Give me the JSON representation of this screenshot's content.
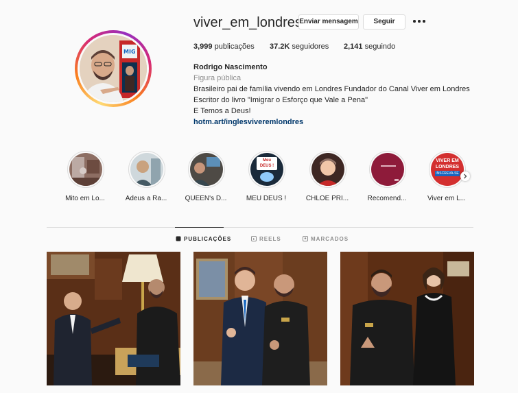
{
  "profile": {
    "username": "viver_em_londres",
    "message_button": "Enviar mensagem",
    "follow_button": "Seguir",
    "stats": {
      "posts_count": "3,999",
      "posts_label": "publicações",
      "followers_count": "37.2K",
      "followers_label": "seguidores",
      "following_count": "2,141",
      "following_label": "seguindo"
    },
    "full_name": "Rodrigo Nascimento",
    "category": "Figura pública",
    "bio_lines": [
      "Brasileiro pai de família vivendo em Londres Fundador do Canal Viver em Londres",
      "Escritor do livro \"Imigrar o Esforço que Vale a Pena\"",
      "E Temos a Deus!"
    ],
    "link": "hotm.art/inglesviveremlondres",
    "avatar_icon": "profile-photo"
  },
  "highlights": [
    {
      "label": "Mito em Lo..."
    },
    {
      "label": "Adeus a Ra..."
    },
    {
      "label": "QUEEN's D..."
    },
    {
      "label": "MEU DEUS !",
      "badge": "Meu DEUS !"
    },
    {
      "label": "CHLOE PRI..."
    },
    {
      "label": "Recomend..."
    },
    {
      "label": "Viver em L...",
      "badge": "VIVER EM LONDRES",
      "badge_sub": "INSCREVA-SE"
    }
  ],
  "tabs": [
    {
      "label": "PUBLICAÇÕES",
      "icon": "grid-icon",
      "active": true
    },
    {
      "label": "REELS",
      "icon": "reels-icon",
      "active": false
    },
    {
      "label": "MARCADOS",
      "icon": "tagged-icon",
      "active": false
    }
  ],
  "colors": {
    "text": "#262626",
    "muted": "#8e8e8e",
    "link": "#00376b",
    "border": "#dbdbdb",
    "background": "#fafafa"
  }
}
